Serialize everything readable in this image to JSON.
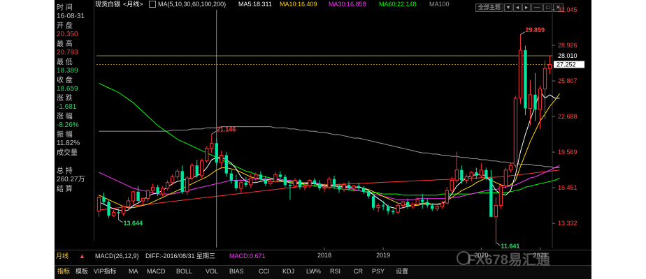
{
  "header": {
    "title": "现货白银",
    "period": "<月线>",
    "ma_label": "MA(5,10,30,60,100,200)",
    "ma5": "MA5:18.311",
    "ma10": "MA10:16.409",
    "ma30": "MA30:16.858",
    "ma60": "MA60:22.148",
    "ma100": "MA100",
    "theme": "全部主题",
    "colors": {
      "ma5": "#ffffff",
      "ma10": "#ffd700",
      "ma30": "#ff33ff",
      "ma60": "#00ff00",
      "ma100": "#9a9a9a",
      "ma200": "#ff3333"
    }
  },
  "sidebar": [
    {
      "label": "时 间",
      "value": "16-08-31",
      "color": "#c8c8c8"
    },
    {
      "label": "开 盘",
      "value": "20.350",
      "color": "#ff4444"
    },
    {
      "label": "最 高",
      "value": "20.793",
      "color": "#ff4444"
    },
    {
      "label": "最 低",
      "value": "18.389",
      "color": "#22dd66"
    },
    {
      "label": "收 盘",
      "value": "18.659",
      "color": "#22dd66"
    },
    {
      "label": "涨 跌",
      "value": "-1.681",
      "color": "#22dd66"
    },
    {
      "label": "涨 幅",
      "value": "-8.26%",
      "color": "#22dd66"
    },
    {
      "label": "振 幅",
      "value": "11.82%",
      "color": "#c8c8c8"
    },
    {
      "label": "成交量",
      "value": "",
      "color": "#c8c8c8"
    },
    {
      "label": "总 持",
      "value": "260.27万",
      "color": "#c8c8c8"
    },
    {
      "label": "结 算",
      "value": "",
      "color": "#c8c8c8"
    }
  ],
  "sidebar_footer": {
    "period": "月线",
    "arrow": "▲"
  },
  "macd": {
    "label": "MACD(26,12,9)",
    "diff": "DIFF:-2016/08/31 星期三",
    "macd": "MACD:0.671"
  },
  "tabs": [
    "指标",
    "模板",
    "VIP指标",
    "MA",
    "MACD",
    "BOLL",
    "VOL",
    "BIAS",
    "CCI",
    "KDJ",
    "LW%",
    "RSI",
    "CR",
    "PSY",
    "设置"
  ],
  "watermark": "FX678易汇通",
  "controls": [
    "全部主题",
    "▾",
    "◂",
    "▸",
    "—",
    "□",
    "✕"
  ],
  "chart_data": {
    "type": "candlestick",
    "title": "现货白银<月线>",
    "y_ticks": [
      "32.045",
      "28.926",
      "25.807",
      "22.688",
      "19.569",
      "16.451",
      "13.332"
    ],
    "ylim": [
      11.2,
      32.045
    ],
    "x_labels": [
      "2018",
      "2019",
      "2020",
      "2021"
    ],
    "annotations": [
      {
        "text": "29.859",
        "value": 29.859,
        "kind": "high"
      },
      {
        "text": "11.641",
        "value": 11.641,
        "kind": "low"
      },
      {
        "text": "21.146",
        "value": 21.146,
        "kind": "high"
      },
      {
        "text": "13.644",
        "value": 13.644,
        "kind": "low"
      }
    ],
    "price_lines": [
      {
        "text": "28.010",
        "value": 28.01,
        "style": "solid"
      },
      {
        "text": "27.252",
        "value": 27.252,
        "style": "dashed",
        "current": true
      }
    ],
    "crosshair_index": 24,
    "candles": [
      [
        14.4,
        15.8,
        13.9,
        15.6
      ],
      [
        15.6,
        16.0,
        15.0,
        15.2
      ],
      [
        15.2,
        15.4,
        13.8,
        14.0
      ],
      [
        14.0,
        14.5,
        13.9,
        14.3
      ],
      [
        14.3,
        14.6,
        13.644,
        14.2
      ],
      [
        14.2,
        14.9,
        14.0,
        14.8
      ],
      [
        14.8,
        15.6,
        14.5,
        15.3
      ],
      [
        15.3,
        16.2,
        15.0,
        16.1
      ],
      [
        16.1,
        16.6,
        15.2,
        15.3
      ],
      [
        15.3,
        15.6,
        14.9,
        15.5
      ],
      [
        15.5,
        16.3,
        15.2,
        16.2
      ],
      [
        16.2,
        16.8,
        16.0,
        16.5
      ],
      [
        16.5,
        16.7,
        15.7,
        15.9
      ],
      [
        15.9,
        16.6,
        15.7,
        16.4
      ],
      [
        16.4,
        17.1,
        16.2,
        16.9
      ],
      [
        16.9,
        17.6,
        16.7,
        17.4
      ],
      [
        17.4,
        18.1,
        17.2,
        17.9
      ],
      [
        17.9,
        18.4,
        15.9,
        16.1
      ],
      [
        16.1,
        17.5,
        15.8,
        17.3
      ],
      [
        17.3,
        18.6,
        17.1,
        18.4
      ],
      [
        18.4,
        18.9,
        17.3,
        17.5
      ],
      [
        17.5,
        19.0,
        17.3,
        18.8
      ],
      [
        18.8,
        20.1,
        18.6,
        19.9
      ],
      [
        19.9,
        21.146,
        19.5,
        20.35
      ],
      [
        20.35,
        20.793,
        18.389,
        18.659
      ],
      [
        18.659,
        19.7,
        18.1,
        19.3
      ],
      [
        19.3,
        19.6,
        17.4,
        17.7
      ],
      [
        17.7,
        18.0,
        16.8,
        17.1
      ],
      [
        17.1,
        17.6,
        16.2,
        16.4
      ],
      [
        16.4,
        17.2,
        16.0,
        16.9
      ],
      [
        16.9,
        17.4,
        16.5,
        16.7
      ],
      [
        16.7,
        17.7,
        16.4,
        17.3
      ],
      [
        17.3,
        17.8,
        17.0,
        17.6
      ],
      [
        17.6,
        17.9,
        17.1,
        17.2
      ],
      [
        17.2,
        17.5,
        16.6,
        16.8
      ],
      [
        16.8,
        17.3,
        16.6,
        17.0
      ],
      [
        17.0,
        17.8,
        16.9,
        17.6
      ],
      [
        17.6,
        17.9,
        17.2,
        17.4
      ],
      [
        17.4,
        17.6,
        16.5,
        16.7
      ],
      [
        16.7,
        17.1,
        15.4,
        16.6
      ],
      [
        16.6,
        17.3,
        16.4,
        17.1
      ],
      [
        17.1,
        17.2,
        16.3,
        16.5
      ],
      [
        16.5,
        16.9,
        16.2,
        16.6
      ],
      [
        16.6,
        17.2,
        16.4,
        17.1
      ],
      [
        17.1,
        17.3,
        16.6,
        16.8
      ],
      [
        16.8,
        17.1,
        16.2,
        16.4
      ],
      [
        16.4,
        16.8,
        16.1,
        16.5
      ],
      [
        16.5,
        17.4,
        16.3,
        17.2
      ],
      [
        17.2,
        17.5,
        16.4,
        16.6
      ],
      [
        16.6,
        16.8,
        16.0,
        16.3
      ],
      [
        16.3,
        16.9,
        16.1,
        16.7
      ],
      [
        16.7,
        17.0,
        16.2,
        16.4
      ],
      [
        16.4,
        16.7,
        16.1,
        16.6
      ],
      [
        16.6,
        16.9,
        16.2,
        16.4
      ],
      [
        16.4,
        16.6,
        15.9,
        16.1
      ],
      [
        16.1,
        16.3,
        15.5,
        15.7
      ],
      [
        15.7,
        15.9,
        14.5,
        14.7
      ],
      [
        14.7,
        15.1,
        14.3,
        14.9
      ],
      [
        14.9,
        15.3,
        14.5,
        14.8
      ],
      [
        14.8,
        15.0,
        14.1,
        14.4
      ],
      [
        14.4,
        14.6,
        14.1,
        14.3
      ],
      [
        14.3,
        15.0,
        14.2,
        14.9
      ],
      [
        14.9,
        15.3,
        14.6,
        15.2
      ],
      [
        15.2,
        15.5,
        14.6,
        14.8
      ],
      [
        14.8,
        15.2,
        14.6,
        15.0
      ],
      [
        15.0,
        15.6,
        14.9,
        15.4
      ],
      [
        15.4,
        15.9,
        14.6,
        15.2
      ],
      [
        15.2,
        15.5,
        14.7,
        14.9
      ],
      [
        14.9,
        15.1,
        14.4,
        14.6
      ],
      [
        14.6,
        15.0,
        14.4,
        14.8
      ],
      [
        14.8,
        15.3,
        14.6,
        15.1
      ],
      [
        15.1,
        16.5,
        15.0,
        16.2
      ],
      [
        16.2,
        17.4,
        16.0,
        17.1
      ],
      [
        17.1,
        19.6,
        16.9,
        18.0
      ],
      [
        18.0,
        18.4,
        16.8,
        17.1
      ],
      [
        17.1,
        17.6,
        16.8,
        17.4
      ],
      [
        17.4,
        17.9,
        17.0,
        17.8
      ],
      [
        17.8,
        18.2,
        17.2,
        17.5
      ],
      [
        17.5,
        18.6,
        17.3,
        18.0
      ],
      [
        18.0,
        18.2,
        17.1,
        17.3
      ],
      [
        17.3,
        18.0,
        16.2,
        13.9
      ],
      [
        13.9,
        15.6,
        11.641,
        14.9
      ],
      [
        14.9,
        16.8,
        14.6,
        16.6
      ],
      [
        16.6,
        18.2,
        16.4,
        18.0
      ],
      [
        18.0,
        18.6,
        17.8,
        18.4
      ],
      [
        18.4,
        24.5,
        18.2,
        24.3
      ],
      [
        24.3,
        29.859,
        23.8,
        28.5
      ],
      [
        28.5,
        28.9,
        22.8,
        23.4
      ],
      [
        23.4,
        25.9,
        21.9,
        24.6
      ],
      [
        24.6,
        26.5,
        22.3,
        23.3
      ],
      [
        23.3,
        25.4,
        21.6,
        25.1
      ],
      [
        25.1,
        27.6,
        22.5,
        26.9
      ],
      [
        26.9,
        28.01,
        26.4,
        27.252
      ]
    ],
    "ma5": [
      15.2,
      15.0,
      14.8,
      14.6,
      14.5,
      14.4,
      14.5,
      14.9,
      15.1,
      15.4,
      15.7,
      15.9,
      16.0,
      16.2,
      16.5,
      16.8,
      17.0,
      17.1,
      17.2,
      17.3,
      17.5,
      17.7,
      18.2,
      18.9,
      19.1,
      19.1,
      18.9,
      18.6,
      18.1,
      17.4,
      17.0,
      16.9,
      16.9,
      17.0,
      17.1,
      17.2,
      17.2,
      17.1,
      17.0,
      16.9,
      16.8,
      16.8,
      16.8,
      16.9,
      16.8,
      16.7,
      16.6,
      16.6,
      16.6,
      16.6,
      16.5,
      16.5,
      16.5,
      16.5,
      16.4,
      16.2,
      15.8,
      15.5,
      15.2,
      14.8,
      14.7,
      14.6,
      14.7,
      14.8,
      14.9,
      15.0,
      15.1,
      15.1,
      15.0,
      15.0,
      15.0,
      15.4,
      15.9,
      16.6,
      17.0,
      17.3,
      17.5,
      17.6,
      17.6,
      17.5,
      16.9,
      16.2,
      15.9,
      15.8,
      16.2,
      17.6,
      19.6,
      21.1,
      22.4,
      23.6,
      24.9,
      24.3,
      24.6,
      24.3,
      24.3
    ],
    "ma10": [
      15.8,
      15.6,
      15.4,
      15.2,
      15.0,
      14.8,
      14.7,
      14.7,
      14.8,
      14.9,
      15.0,
      15.2,
      15.4,
      15.6,
      15.8,
      16.0,
      16.2,
      16.4,
      16.6,
      16.8,
      17.0,
      17.2,
      17.4,
      17.7,
      18.0,
      18.2,
      18.2,
      18.1,
      18.0,
      17.8,
      17.6,
      17.4,
      17.3,
      17.2,
      17.1,
      17.0,
      17.0,
      17.0,
      17.0,
      17.0,
      16.9,
      16.9,
      16.8,
      16.8,
      16.8,
      16.7,
      16.7,
      16.7,
      16.6,
      16.6,
      16.6,
      16.5,
      16.5,
      16.5,
      16.4,
      16.3,
      16.1,
      15.9,
      15.7,
      15.5,
      15.3,
      15.1,
      15.0,
      14.9,
      14.9,
      14.9,
      15.0,
      15.0,
      15.0,
      15.0,
      15.1,
      15.3,
      15.6,
      15.9,
      16.2,
      16.4,
      16.6,
      16.9,
      17.1,
      17.3,
      17.1,
      16.9,
      16.7,
      16.6,
      16.7,
      17.1,
      18.3,
      19.4,
      20.5,
      21.4,
      22.3,
      22.9,
      23.6,
      24.1,
      24.7
    ],
    "ma30": [
      17.8,
      17.6,
      17.4,
      17.2,
      17.0,
      16.8,
      16.6,
      16.4,
      16.3,
      16.2,
      16.1,
      16.0,
      15.9,
      15.9,
      15.9,
      15.9,
      16.0,
      16.1,
      16.2,
      16.3,
      16.4,
      16.5,
      16.6,
      16.7,
      16.8,
      16.9,
      17.0,
      17.1,
      17.1,
      17.1,
      17.1,
      17.2,
      17.2,
      17.2,
      17.2,
      17.2,
      17.2,
      17.2,
      17.1,
      17.1,
      17.0,
      16.9,
      16.9,
      16.9,
      16.9,
      16.8,
      16.7,
      16.6,
      16.6,
      16.5,
      16.5,
      16.4,
      16.3,
      16.2,
      16.1,
      16.0,
      15.9,
      15.8,
      15.7,
      15.6,
      15.5,
      15.4,
      15.4,
      15.4,
      15.4,
      15.5,
      15.5,
      15.5,
      15.5,
      15.5,
      15.5,
      15.5,
      15.6,
      15.6,
      15.7,
      15.8,
      15.9,
      16.0,
      16.1,
      16.2,
      16.3,
      16.3,
      16.4,
      16.5,
      16.6,
      16.7,
      16.9,
      17.1,
      17.3,
      17.4,
      17.6,
      17.8,
      18.0,
      18.2,
      18.4
    ],
    "ma60": [
      25.6,
      25.4,
      25.2,
      25.0,
      24.8,
      24.5,
      24.2,
      23.9,
      23.5,
      23.1,
      22.7,
      22.3,
      21.9,
      21.6,
      21.3,
      21.0,
      20.7,
      20.5,
      20.3,
      20.1,
      19.9,
      19.7,
      19.5,
      19.3,
      19.1,
      18.9,
      18.7,
      18.5,
      18.3,
      18.1,
      17.9,
      17.8,
      17.6,
      17.5,
      17.4,
      17.3,
      17.2,
      17.1,
      17.0,
      16.9,
      16.8,
      16.8,
      16.7,
      16.7,
      16.6,
      16.6,
      16.5,
      16.5,
      16.4,
      16.4,
      16.3,
      16.3,
      16.2,
      16.2,
      16.1,
      16.1,
      16.0,
      16.0,
      15.9,
      15.9,
      15.9,
      15.9,
      15.8,
      15.8,
      15.8,
      15.8,
      15.8,
      15.8,
      15.8,
      15.8,
      15.9,
      15.9,
      15.9,
      15.9,
      15.9,
      15.9,
      15.9,
      16.0,
      16.0,
      16.0,
      16.0,
      16.0,
      16.0,
      16.0,
      16.1,
      16.2,
      16.3,
      16.5,
      16.6,
      16.7,
      16.8,
      16.9,
      17.0,
      17.1,
      17.3
    ],
    "ma100": [
      21.4,
      21.4,
      21.4,
      21.4,
      21.4,
      21.4,
      21.4,
      21.4,
      21.4,
      21.4,
      21.4,
      21.4,
      21.4,
      21.4,
      21.4,
      21.5,
      21.5,
      21.5,
      21.5,
      21.6,
      21.6,
      21.6,
      21.7,
      21.7,
      21.7,
      21.8,
      21.8,
      21.8,
      21.8,
      21.8,
      21.8,
      21.8,
      21.8,
      21.8,
      21.8,
      21.8,
      21.7,
      21.7,
      21.7,
      21.6,
      21.6,
      21.5,
      21.5,
      21.4,
      21.4,
      21.3,
      21.3,
      21.2,
      21.1,
      21.1,
      21.0,
      20.9,
      20.8,
      20.8,
      20.7,
      20.6,
      20.5,
      20.4,
      20.3,
      20.2,
      20.1,
      20.0,
      19.9,
      19.8,
      19.7,
      19.6,
      19.5,
      19.5,
      19.4,
      19.4,
      19.3,
      19.3,
      19.2,
      19.2,
      19.1,
      19.1,
      19.0,
      19.0,
      18.9,
      18.9,
      18.8,
      18.8,
      18.7,
      18.7,
      18.6,
      18.6,
      18.5,
      18.5,
      18.5,
      18.4,
      18.4,
      18.3,
      18.3,
      18.2,
      18.2
    ],
    "ma200": [
      14.5,
      14.55,
      14.6,
      14.65,
      14.7,
      14.75,
      14.8,
      14.85,
      14.9,
      14.95,
      15.0,
      15.05,
      15.1,
      15.15,
      15.2,
      15.25,
      15.3,
      15.35,
      15.4,
      15.45,
      15.5,
      15.55,
      15.6,
      15.65,
      15.7,
      15.75,
      15.8,
      15.85,
      15.9,
      15.95,
      16.0,
      16.05,
      16.1,
      16.15,
      16.2,
      16.25,
      16.3,
      16.35,
      16.4,
      16.45,
      16.5,
      16.55,
      16.6,
      16.62,
      16.64,
      16.66,
      16.68,
      16.7,
      16.72,
      16.74,
      16.76,
      16.78,
      16.8,
      16.82,
      16.84,
      16.86,
      16.88,
      16.9,
      16.92,
      16.94,
      16.96,
      16.98,
      17.0,
      17.02,
      17.04,
      17.06,
      17.08,
      17.1,
      17.12,
      17.14,
      17.16,
      17.18,
      17.2,
      17.22,
      17.24,
      17.26,
      17.28,
      17.3,
      17.32,
      17.34,
      17.36,
      17.38,
      17.4,
      17.45,
      17.5,
      17.55,
      17.6,
      17.65,
      17.7,
      17.75,
      17.8,
      17.85,
      17.9,
      17.95,
      18.0
    ]
  }
}
